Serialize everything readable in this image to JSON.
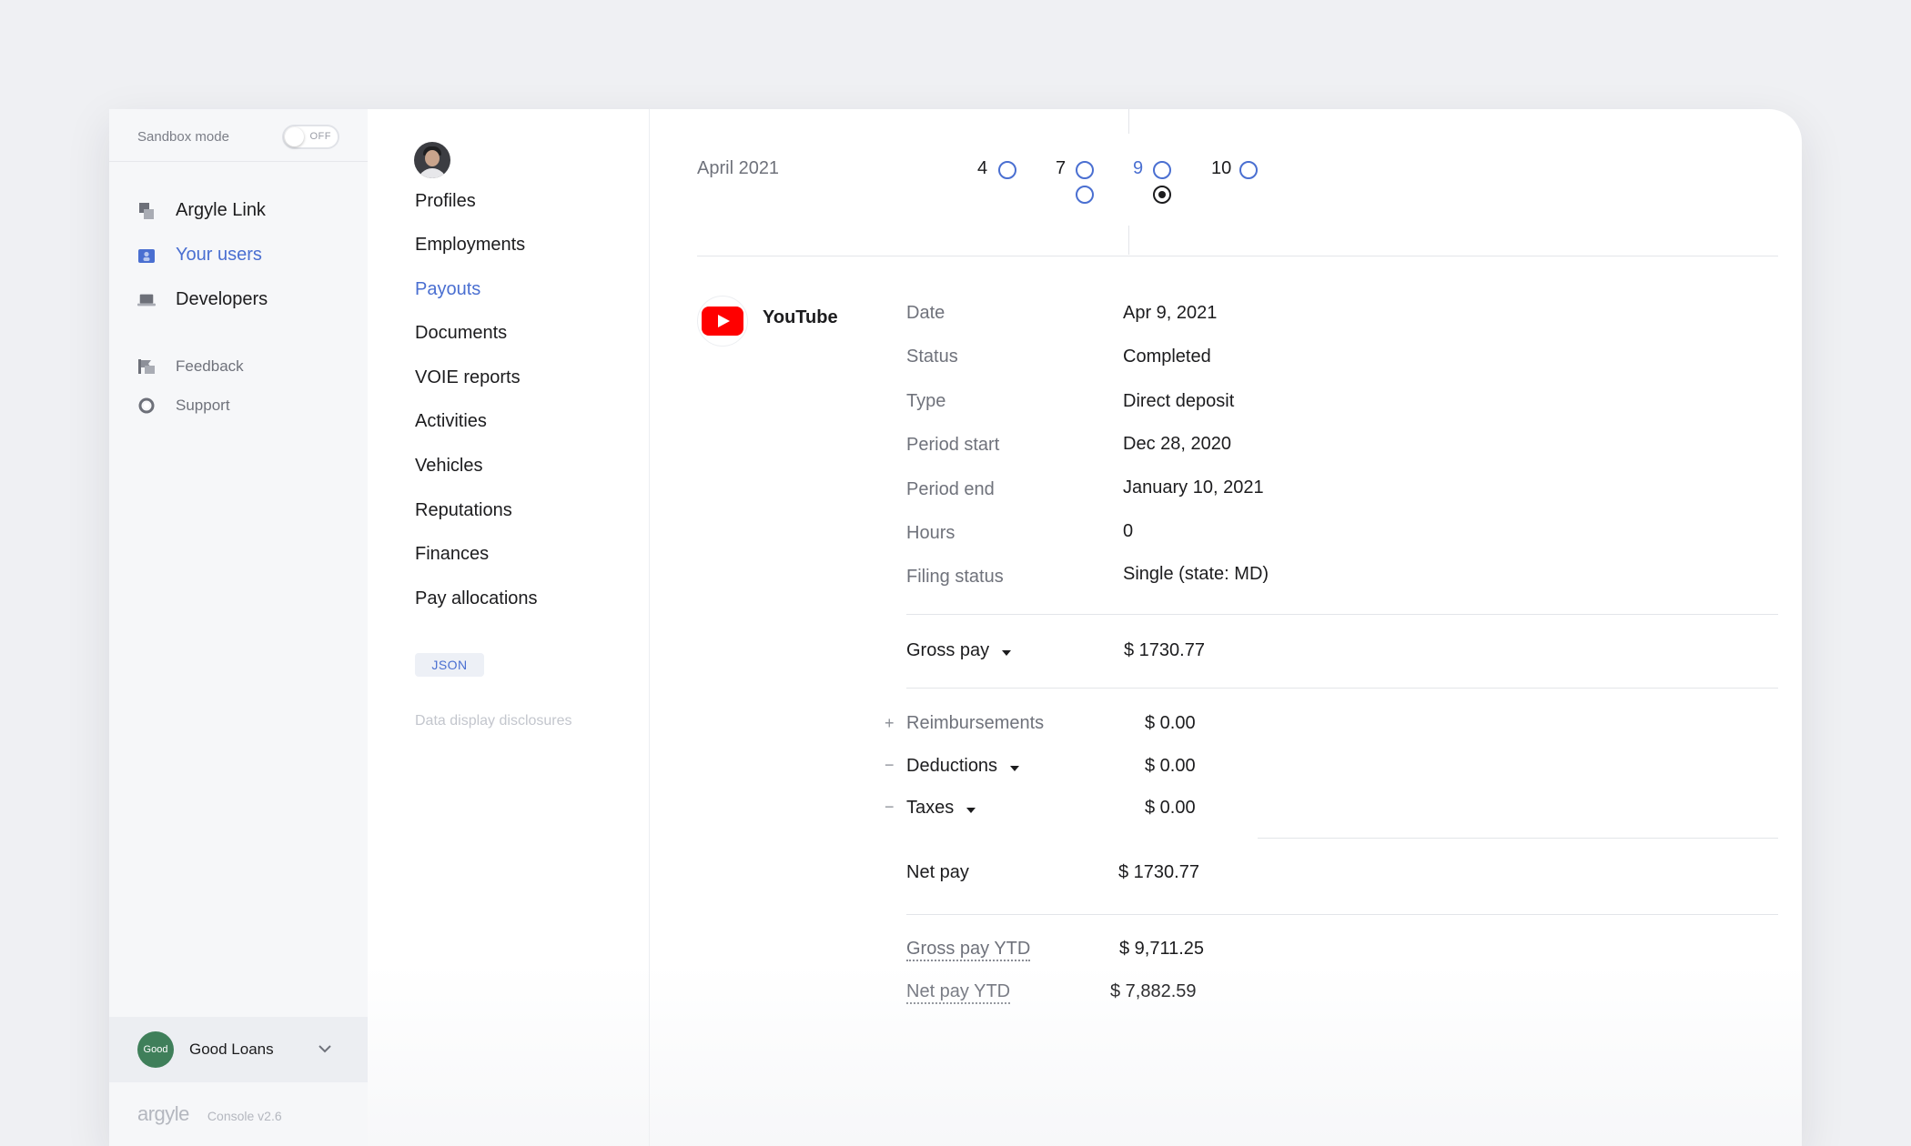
{
  "sidebar": {
    "sandbox_label": "Sandbox mode",
    "toggle_state": "OFF",
    "items": [
      {
        "label": "Argyle Link",
        "icon": "link-stack-icon"
      },
      {
        "label": "Your users",
        "icon": "users-icon"
      },
      {
        "label": "Developers",
        "icon": "laptop-icon"
      }
    ],
    "secondary_items": [
      {
        "label": "Feedback",
        "icon": "feedback-flag-icon"
      },
      {
        "label": "Support",
        "icon": "support-ring-icon"
      }
    ],
    "org": {
      "avatar_text": "Good",
      "name": "Good Loans"
    },
    "brand": "argyle",
    "version": "Console v2.6"
  },
  "nav": {
    "items": [
      "Profiles",
      "Employments",
      "Payouts",
      "Documents",
      "VOIE reports",
      "Activities",
      "Vehicles",
      "Reputations",
      "Finances",
      "Pay allocations"
    ],
    "active": "Payouts",
    "json_button": "JSON",
    "disclosures": "Data display disclosures"
  },
  "main": {
    "month": "April 2021",
    "days": [
      {
        "num": "4",
        "radios": 1,
        "selected_index": -1,
        "highlight": false
      },
      {
        "num": "7",
        "radios": 2,
        "selected_index": -1,
        "highlight": false
      },
      {
        "num": "9",
        "radios": 2,
        "selected_index": 1,
        "highlight": true
      },
      {
        "num": "10",
        "radios": 1,
        "selected_index": -1,
        "highlight": false
      }
    ],
    "employer": "YouTube",
    "details": [
      {
        "label": "Date",
        "value": "Apr 9, 2021"
      },
      {
        "label": "Status",
        "value": "Completed"
      },
      {
        "label": "Type",
        "value": "Direct deposit"
      },
      {
        "label": "Period start",
        "value": "Dec 28, 2020"
      },
      {
        "label": "Period end",
        "value": "January 10, 2021"
      },
      {
        "label": "Hours",
        "value": "0"
      },
      {
        "label": "Filing status",
        "value": "Single (state: MD)"
      }
    ],
    "gross_pay": {
      "label": "Gross pay",
      "value": "$ 1730.77"
    },
    "adjustments": [
      {
        "sign": "+",
        "label": "Reimbursements",
        "value": "$ 0.00",
        "dropdown": false
      },
      {
        "sign": "−",
        "label": "Deductions",
        "value": "$ 0.00",
        "dropdown": true
      },
      {
        "sign": "−",
        "label": "Taxes",
        "value": "$ 0.00",
        "dropdown": true
      }
    ],
    "net_pay": {
      "label": "Net pay",
      "value": "$ 1730.77"
    },
    "ytd": [
      {
        "label": "Gross pay YTD",
        "value": "$ 9,711.25"
      },
      {
        "label": "Net pay YTD",
        "value": "$ 7,882.59"
      }
    ]
  },
  "colors": {
    "accent": "#4a6fd1",
    "page_bg": "#eff0f3",
    "sidebar_bg": "#f6f7f9",
    "youtube_red": "#ff0000",
    "org_green": "#3f7f5a"
  }
}
